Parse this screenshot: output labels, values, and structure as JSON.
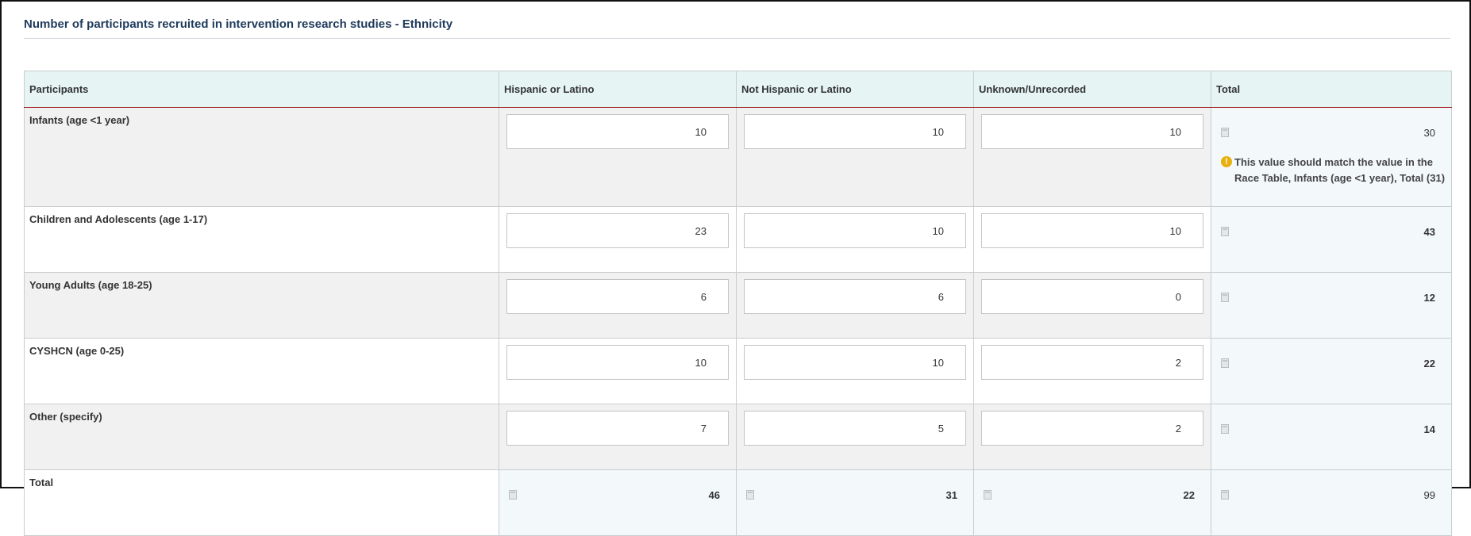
{
  "section": {
    "title": "Number of participants recruited in intervention research studies - Ethnicity"
  },
  "table": {
    "headers": [
      "Participants",
      "Hispanic or Latino",
      "Not Hispanic or Latino",
      "Unknown/Unrecorded",
      "Total"
    ],
    "rows": [
      {
        "label": "Infants (age <1 year)",
        "values": [
          "10",
          "10",
          "10"
        ],
        "total": "30",
        "warning": "This value should match the value in the Race Table, Infants (age <1 year), Total (31)"
      },
      {
        "label": "Children and Adolescents (age 1-17)",
        "values": [
          "23",
          "10",
          "10"
        ],
        "total": "43"
      },
      {
        "label": "Young Adults (age 18-25)",
        "values": [
          "6",
          "6",
          "0"
        ],
        "total": "12"
      },
      {
        "label": "CYSHCN (age 0-25)",
        "values": [
          "10",
          "10",
          "2"
        ],
        "total": "22"
      },
      {
        "label": "Other (specify)",
        "values": [
          "7",
          "5",
          "2"
        ],
        "total": "14"
      }
    ],
    "total_row": {
      "label": "Total",
      "values": [
        "46",
        "31",
        "22"
      ],
      "total": "99"
    }
  },
  "icons": {
    "calculated": "calculator-icon",
    "warning": "exclamation-circle-icon"
  },
  "colors": {
    "header_bg": "#e6f5f4",
    "header_rule": "#a5262b",
    "title": "#1f3b5b",
    "warning": "#e8b00d",
    "calc_bg": "#f3f8fb"
  }
}
